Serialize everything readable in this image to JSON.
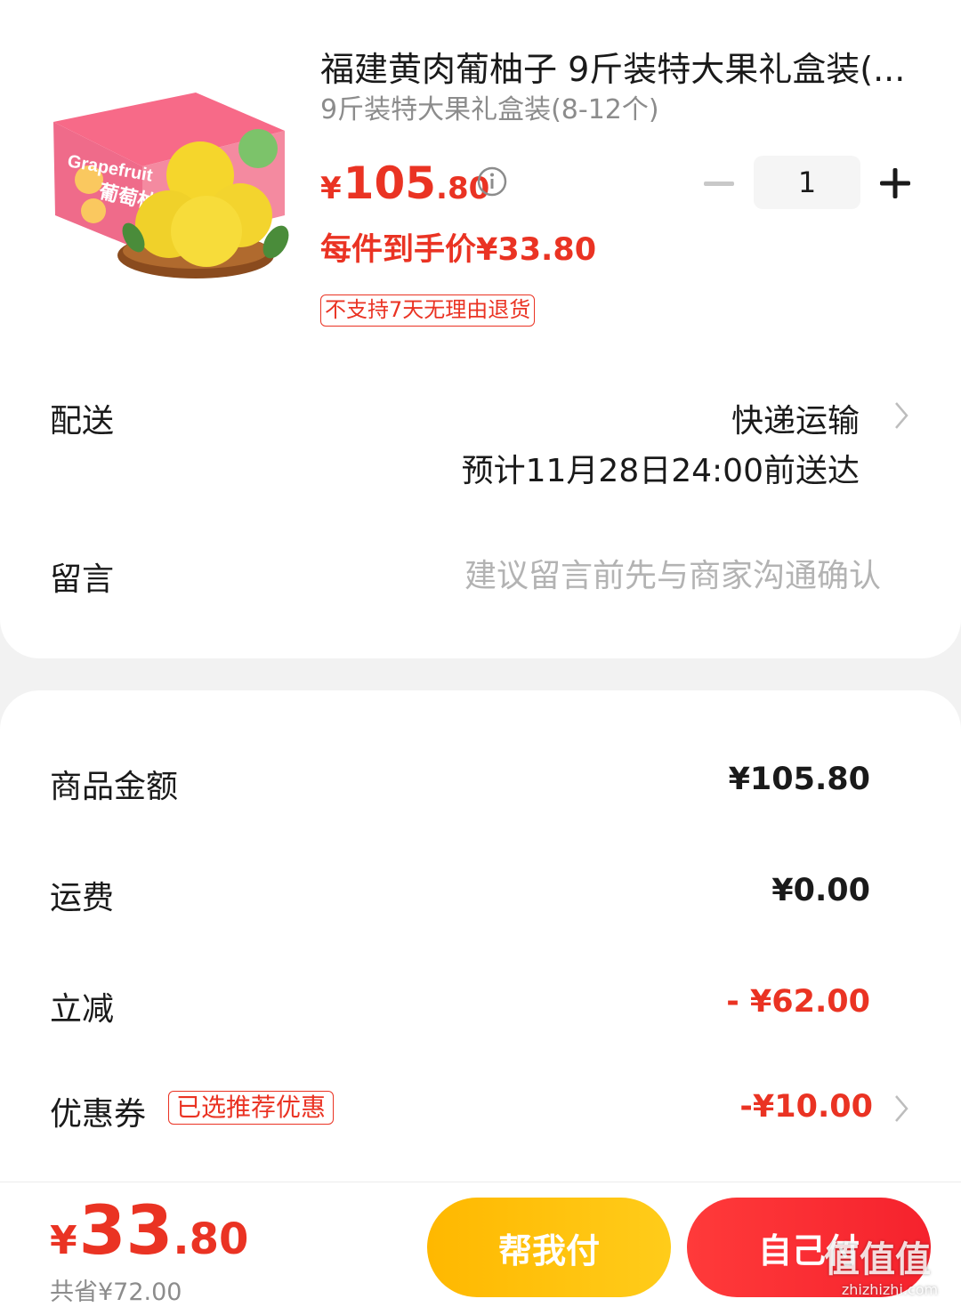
{
  "product": {
    "title": "福建黄肉葡柚子 9斤装特大果礼盒装(...",
    "spec": "9斤装特大果礼盒装(8-12个)",
    "price_currency": "¥",
    "price_int": "105",
    "price_dec": ".80",
    "per_item_price": "每件到手价¥33.80",
    "return_tag": "不支持7天无理由退货",
    "quantity": "1",
    "box_text": "Grapefruit",
    "box_text_cn": "葡萄柚"
  },
  "delivery": {
    "label": "配送",
    "method": "快递运输",
    "eta": "预计11月28日24:00前送达"
  },
  "note": {
    "label": "留言",
    "placeholder": "建议留言前先与商家沟通确认"
  },
  "summary": {
    "goods_label": "商品金额",
    "goods_value": "¥105.80",
    "shipping_label": "运费",
    "shipping_value": "¥0.00",
    "discount_label": "立减",
    "discount_value": "- ¥62.00",
    "coupon_label": "优惠券",
    "coupon_tag": "已选推荐优惠",
    "coupon_value": "-¥10.00"
  },
  "footer": {
    "total_currency": "¥",
    "total_int": "33",
    "total_dec": ".80",
    "saved": "共省¥72.00",
    "help_pay_label": "帮我付",
    "self_pay_label": "自己付"
  },
  "watermark": {
    "logo": "值值值",
    "url": "zhizhizhi.com"
  },
  "colors": {
    "accent_red": "#ea3323",
    "help_yellow": "#ffbe0a",
    "background": "#f2f2f2"
  },
  "icons": [
    "info-icon",
    "minus-icon",
    "plus-icon",
    "chevron-right-icon"
  ]
}
